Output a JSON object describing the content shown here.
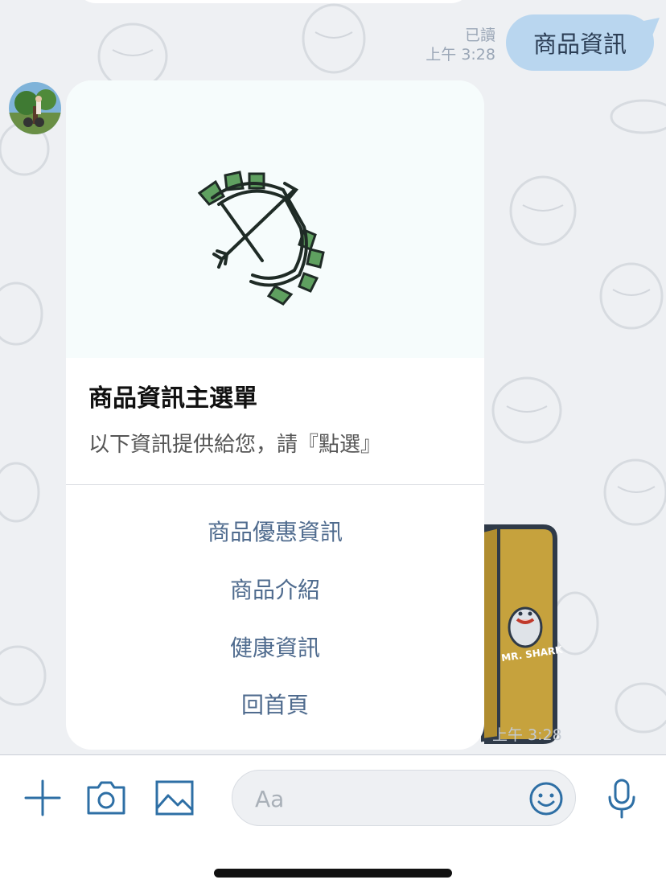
{
  "chat": {
    "sent_message": {
      "text": "商品資訊",
      "read_label": "已讀",
      "time": "上午 3:28"
    },
    "received_time": "上午 3:28",
    "sticker": {
      "text": "MR. SHARK"
    }
  },
  "card": {
    "logo_icon": "bow-arrow-icon",
    "title": "商品資訊主選單",
    "subtitle": "以下資訊提供給您，請『點選』",
    "buttons": [
      {
        "label": "商品優惠資訊"
      },
      {
        "label": "商品介紹"
      },
      {
        "label": "健康資訊"
      },
      {
        "label": "回首頁"
      }
    ]
  },
  "input_bar": {
    "icons": [
      "plus-icon",
      "camera-icon",
      "image-icon",
      "emoji-icon",
      "microphone-icon"
    ],
    "placeholder": "Aa",
    "accent_color": "#2e6fa5"
  }
}
